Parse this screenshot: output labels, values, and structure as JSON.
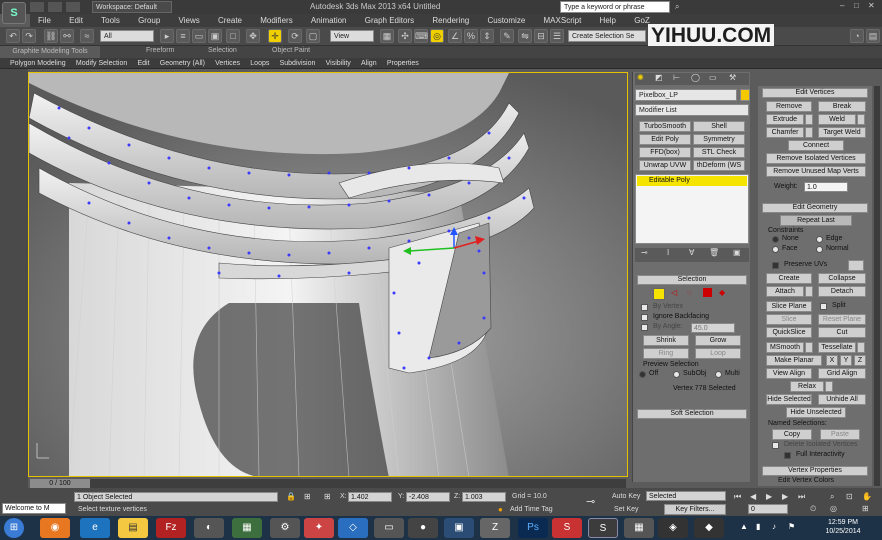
{
  "window": {
    "title": "Autodesk 3ds Max  2013 x64     Untitled",
    "workspace": "Workspace: Default",
    "search_placeholder": "Type a keyword or phrase"
  },
  "menu": [
    "File",
    "Edit",
    "Tools",
    "Group",
    "Views",
    "Create",
    "Modifiers",
    "Animation",
    "Graph Editors",
    "Rendering",
    "Customize",
    "MAXScript",
    "Help",
    "GoZ"
  ],
  "toolbar": {
    "filter": "All",
    "view": "View",
    "selection_set": "Create Selection Se"
  },
  "watermark": "YIHUU.COM",
  "ribbon": {
    "tabs": [
      "Graphite Modeling Tools",
      "Freeform",
      "Selection",
      "Object Paint"
    ],
    "sub": [
      "Polygon Modeling",
      "Modify Selection",
      "Edit",
      "Geometry (All)",
      "Vertices",
      "Loops",
      "Subdivision",
      "Visibility",
      "Align",
      "Properties"
    ]
  },
  "command_panel": {
    "object_name": "Pixelbox_LP",
    "modifier_list": "Modifier List",
    "modifier_buttons": [
      "TurboSmooth",
      "Shell",
      "Edit Poly",
      "Symmetry",
      "FFD(box)",
      "STL Check",
      "Unwrap UVW",
      "thDeform (WS"
    ],
    "stack_item": "Editable Poly",
    "selection": {
      "header": "Selection",
      "by_vertex": "By Vertex",
      "ignore_backfacing": "Ignore Backfacing",
      "by_angle": "By Angle:",
      "angle_value": "45.0",
      "shrink": "Shrink",
      "grow": "Grow",
      "ring": "Ring",
      "loop": "Loop",
      "preview": "Preview Selection",
      "off": "Off",
      "subobj": "SubObj",
      "multi": "Multi",
      "status": "Vertex 778 Selected"
    },
    "soft_selection": "Soft Selection"
  },
  "right_panel": {
    "edit_vertices": "Edit Vertices",
    "remove": "Remove",
    "break": "Break",
    "extrude": "Extrude",
    "weld": "Weld",
    "chamfer": "Chamfer",
    "target_weld": "Target Weld",
    "connect": "Connect",
    "remove_isolated": "Remove Isolated Vertices",
    "remove_unused": "Remove Unused Map Verts",
    "weight_label": "Weight:",
    "weight_value": "1.0",
    "edit_geometry": "Edit Geometry",
    "repeat_last": "Repeat Last",
    "constraints": "Constraints",
    "none": "None",
    "edge": "Edge",
    "face": "Face",
    "normal": "Normal",
    "preserve_uvs": "Preserve UVs",
    "create": "Create",
    "collapse": "Collapse",
    "attach": "Attach",
    "detach": "Detach",
    "slice_plane": "Slice Plane",
    "split": "Split",
    "slice": "Slice",
    "reset_plane": "Reset Plane",
    "quickslice": "QuickSlice",
    "cut": "Cut",
    "msmooth": "MSmooth",
    "tessellate": "Tessellate",
    "make_planar": "Make Planar",
    "x": "X",
    "y": "Y",
    "z": "Z",
    "view_align": "View Align",
    "grid_align": "Grid Align",
    "relax": "Relax",
    "hide_selected": "Hide Selected",
    "unhide_all": "Unhide All",
    "hide_unselected": "Hide Unselected",
    "named_selections": "Named Selections:",
    "copy": "Copy",
    "paste": "Paste",
    "delete_isolated": "Delete Isolated Vertices",
    "full_interactivity": "Full Interactivity",
    "vertex_properties": "Vertex Properties",
    "edit_vertex_colors": "Edit Vertex Colors"
  },
  "status": {
    "timeline": "0 / 100",
    "selected": "1 Object Selected",
    "prompt": "Select texture vertices",
    "x": "1.402",
    "y": "-2.408",
    "z": "1.003",
    "grid": "Grid = 10.0",
    "auto_key": "Auto Key",
    "set_key": "Set Key",
    "key_mode": "Selected",
    "key_filters": "Key Filters...",
    "add_time_tag": "Add Time Tag",
    "frame": "0",
    "welcome": "Welcome to M"
  },
  "clock": {
    "time": "12:59 PM",
    "date": "10/25/2014"
  },
  "colors": {
    "selection_yellow": "#f5e400",
    "vertex_blue": "#3b3bff"
  }
}
